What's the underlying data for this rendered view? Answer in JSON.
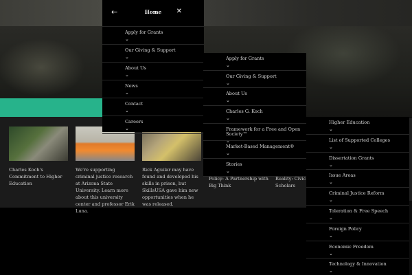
{
  "home_panel": {
    "back_icon": "arrow-left-icon",
    "title": "Home",
    "close_icon": "close-icon",
    "items": [
      {
        "label": "Apply for Grants"
      },
      {
        "label": "Our Giving & Support"
      },
      {
        "label": "About Us"
      },
      {
        "label": "News"
      },
      {
        "label": "Contact"
      },
      {
        "label": "Careers"
      }
    ],
    "chevron": "⌄"
  },
  "about_panel": {
    "items": [
      {
        "label": "Apply for Grants"
      },
      {
        "label": "Our Giving & Support"
      },
      {
        "label": "About Us"
      },
      {
        "label": "Charles G. Koch"
      },
      {
        "label": "Framework for a Free and Open Society™"
      },
      {
        "label": "Market-Based Management®"
      },
      {
        "label": "Stories"
      }
    ]
  },
  "issues_panel": {
    "items": [
      {
        "label": "Higher Education"
      },
      {
        "label": "List of Supported Colleges"
      },
      {
        "label": "Dissertation Grants"
      },
      {
        "label": "Issue Areas"
      },
      {
        "label": "Criminal Justice Reform"
      },
      {
        "label": "Toleration & Free Speech"
      },
      {
        "label": "Foreign Policy"
      },
      {
        "label": "Economic Freedom"
      },
      {
        "label": "Technology & Innovation"
      }
    ]
  },
  "stories": [
    {
      "caption": "Charles Koch's Commitment to Higher Education",
      "image": "elderly-man-reading-photo"
    },
    {
      "caption": "We're supporting criminal justice research at Arizona State University. Learn more about this university center and professor Erik Luna.",
      "image": "inmates-in-orange-photo"
    },
    {
      "caption": "Rick Aguilar may have found and developed his skills in prison, but SkillsUSA gave him new opportunities when he was released.",
      "image": "auto-mechanic-photo"
    }
  ],
  "partial_captions": {
    "first_line_a": "Policy: A Partnership with",
    "second_line_a": "Big Think",
    "first_line_b": "Reality: Civic",
    "second_line_b": "Scholars"
  },
  "colors": {
    "accent": "#27b38b",
    "panel_bg": "#000000",
    "divider": "#262626",
    "text": "#d8d8d8"
  }
}
